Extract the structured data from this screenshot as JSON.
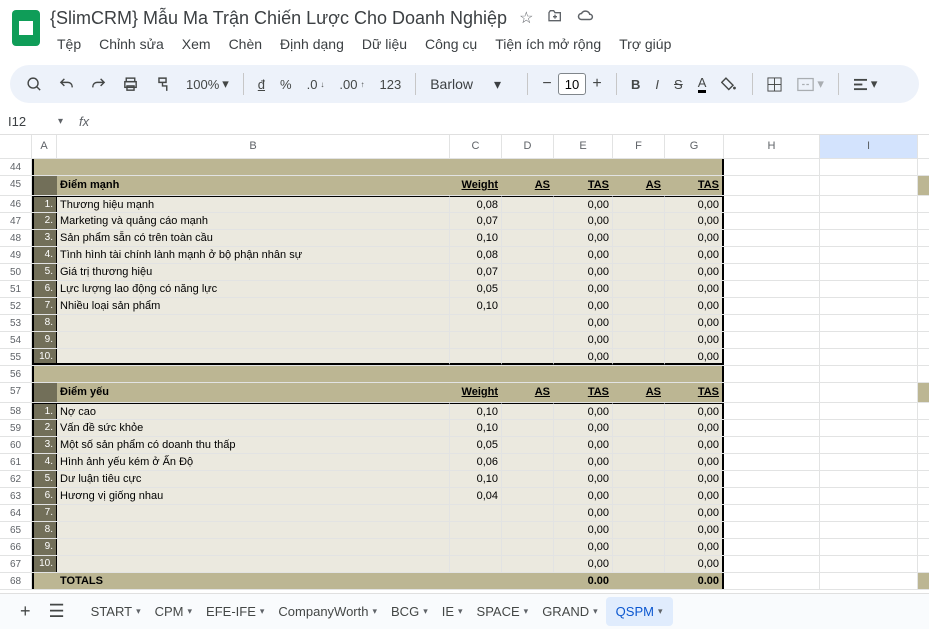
{
  "doc_title": "{SlimCRM} Mẫu Ma Trận Chiến Lược Cho Doanh Nghiệp",
  "menus": [
    "Tệp",
    "Chỉnh sửa",
    "Xem",
    "Chèn",
    "Định dạng",
    "Dữ liệu",
    "Công cụ",
    "Tiện ích mở rộng",
    "Trợ giúp"
  ],
  "zoom": "100%",
  "font": "Barlow",
  "font_size": "10",
  "cell_ref": "I12",
  "columns": [
    "A",
    "B",
    "C",
    "D",
    "E",
    "F",
    "G",
    "H",
    "I"
  ],
  "row_nums": [
    44,
    45,
    46,
    47,
    48,
    49,
    50,
    51,
    52,
    53,
    54,
    55,
    56,
    57,
    58,
    59,
    60,
    61,
    62,
    63,
    64,
    65,
    66,
    67,
    68
  ],
  "strengths_header": {
    "title": "Điểm mạnh",
    "weight": "Weight",
    "as1": "AS",
    "tas1": "TAS",
    "as2": "AS",
    "tas2": "TAS"
  },
  "strengths": [
    {
      "n": "1.",
      "label": "Thương hiệu mạnh",
      "w": "0,08",
      "e": "0,00",
      "g": "0,00"
    },
    {
      "n": "2.",
      "label": "Marketing và quảng cáo mạnh",
      "w": "0,07",
      "e": "0,00",
      "g": "0,00"
    },
    {
      "n": "3.",
      "label": "Sản phẩm sẵn có trên toàn cầu",
      "w": "0,10",
      "e": "0,00",
      "g": "0,00"
    },
    {
      "n": "4.",
      "label": "Tình hình tài chính lành mạnh ở  bộ phận nhân sự",
      "w": "0,08",
      "e": "0,00",
      "g": "0,00"
    },
    {
      "n": "5.",
      "label": "Giá trị thương hiệu",
      "w": "0,07",
      "e": "0,00",
      "g": "0,00"
    },
    {
      "n": "6.",
      "label": "Lực lượng lao động có năng lực",
      "w": "0,05",
      "e": "0,00",
      "g": "0,00"
    },
    {
      "n": "7.",
      "label": "Nhiều loại  sản phẩm",
      "w": "0,10",
      "e": "0,00",
      "g": "0,00"
    },
    {
      "n": "8.",
      "label": "",
      "w": "",
      "e": "0,00",
      "g": "0,00"
    },
    {
      "n": "9.",
      "label": "",
      "w": "",
      "e": "0,00",
      "g": "0,00"
    },
    {
      "n": "10.",
      "label": "",
      "w": "",
      "e": "0,00",
      "g": "0,00"
    }
  ],
  "weaknesses_header": {
    "title": "Điểm yếu",
    "weight": "Weight",
    "as1": "AS",
    "tas1": "TAS",
    "as2": "AS",
    "tas2": "TAS"
  },
  "weaknesses": [
    {
      "n": "1.",
      "label": "Nợ cao",
      "w": "0,10",
      "e": "0,00",
      "g": "0,00"
    },
    {
      "n": "2.",
      "label": "Vấn đề sức khỏe",
      "w": "0,10",
      "e": "0,00",
      "g": "0,00"
    },
    {
      "n": "3.",
      "label": "Một số sản phẩm  có doanh thu thấp",
      "w": "0,05",
      "e": "0,00",
      "g": "0,00"
    },
    {
      "n": "4.",
      "label": "Hình ảnh yếu kém ở Ấn Độ",
      "w": "0,06",
      "e": "0,00",
      "g": "0,00"
    },
    {
      "n": "5.",
      "label": "Dư luận tiêu cực",
      "w": "0,10",
      "e": "0,00",
      "g": "0,00"
    },
    {
      "n": "6.",
      "label": "Hương vị giống nhau",
      "w": "0,04",
      "e": "0,00",
      "g": "0,00"
    },
    {
      "n": "7.",
      "label": "",
      "w": "",
      "e": "0,00",
      "g": "0,00"
    },
    {
      "n": "8.",
      "label": "",
      "w": "",
      "e": "0,00",
      "g": "0,00"
    },
    {
      "n": "9.",
      "label": "",
      "w": "",
      "e": "0,00",
      "g": "0,00"
    },
    {
      "n": "10.",
      "label": "",
      "w": "",
      "e": "0,00",
      "g": "0,00"
    }
  ],
  "totals": {
    "label": "TOTALS",
    "e": "0.00",
    "g": "0.00"
  },
  "tabs": [
    "START",
    "CPM",
    "EFE-IFE",
    "CompanyWorth",
    "BCG",
    "IE",
    "SPACE",
    "GRAND",
    "QSPM"
  ],
  "active_tab": 8
}
